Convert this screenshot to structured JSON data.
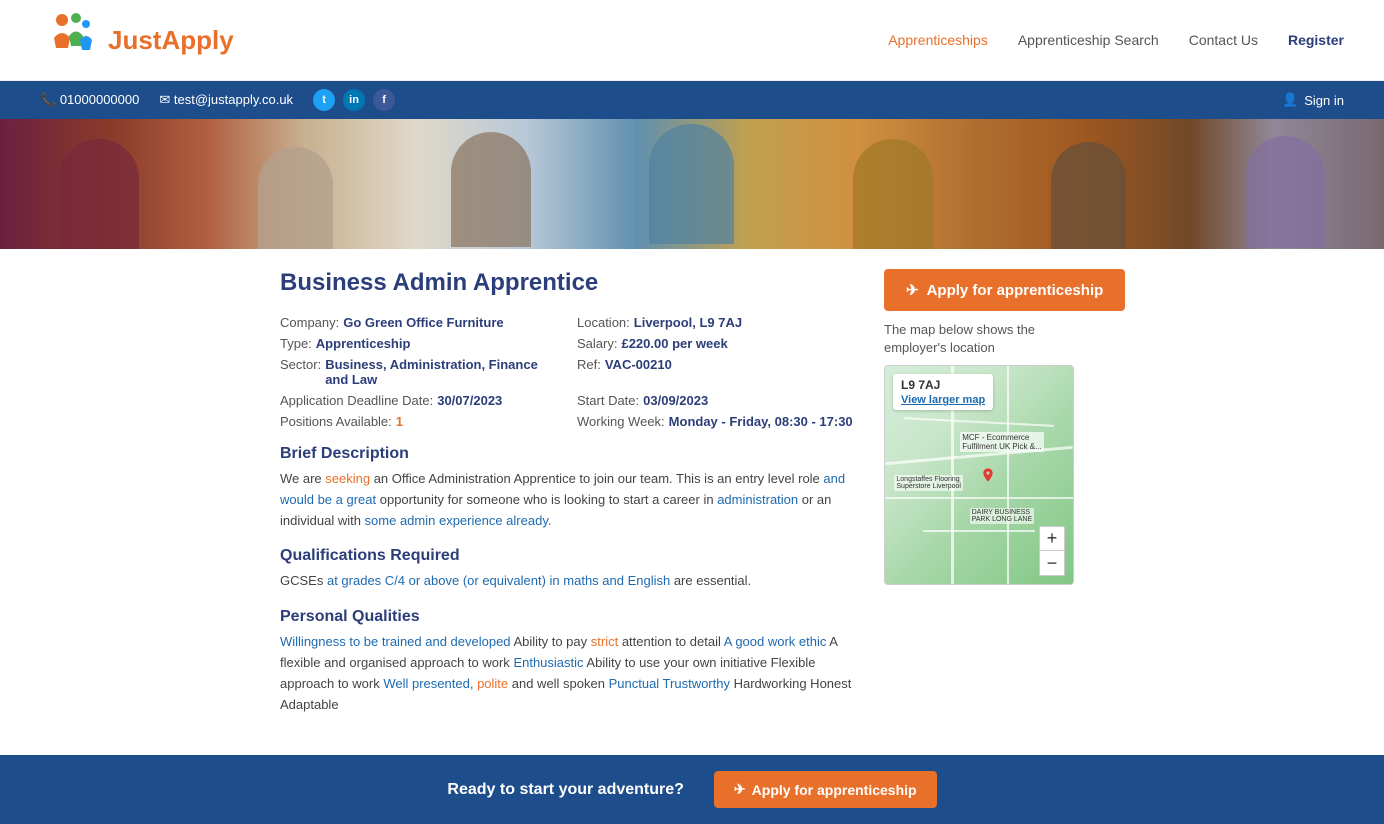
{
  "header": {
    "logo_text_part1": "Just",
    "logo_text_part2": "Apply",
    "nav": {
      "apprenticeships": "Apprenticeships",
      "search": "Apprenticeship Search",
      "contact": "Contact Us",
      "register": "Register"
    }
  },
  "topbar": {
    "phone": "01000000000",
    "email": "test@justapply.co.uk",
    "signin": "Sign in",
    "social": {
      "twitter": "t",
      "linkedin": "in",
      "facebook": "f"
    }
  },
  "job": {
    "title": "Business Admin Apprentice",
    "company_label": "Company:",
    "company_value": "Go Green Office Furniture",
    "location_label": "Location:",
    "location_value": "Liverpool, L9 7AJ",
    "type_label": "Type:",
    "type_value": "Apprenticeship",
    "salary_label": "Salary:",
    "salary_value": "£220.00 per week",
    "sector_label": "Sector:",
    "sector_value": "Business, Administration, Finance and Law",
    "ref_label": "Ref:",
    "ref_value": "VAC-00210",
    "deadline_label": "Application Deadline Date:",
    "deadline_value": "30/07/2023",
    "start_label": "Start Date:",
    "start_value": "03/09/2023",
    "positions_label": "Positions Available:",
    "positions_value": "1",
    "working_label": "Working Week:",
    "working_value": "Monday - Friday, 08:30 - 17:30",
    "apply_button": "Apply for apprenticeship",
    "brief_title": "Brief Description",
    "brief_text": "We are seeking an Office Administration Apprentice to join our team. This is an entry level role and would be a great opportunity for someone who is looking to start a career in administration or an individual with some admin experience already.",
    "qualifications_title": "Qualifications Required",
    "qualifications_text": "GCSEs at grades C/4 or above (or equivalent) in maths and English are essential.",
    "personal_title": "Personal Qualities",
    "personal_text": "Willingness to be trained and developed Ability to pay strict attention to detail A good work ethic A flexible and organised approach to work Enthusiastic Ability to use your own initiative Flexible approach to work Well presented, polite and well spoken Punctual Trustworthy Hardworking Honest Adaptable"
  },
  "sidebar": {
    "map_note": "The map below shows the employer's location",
    "map_label": "L9 7AJ",
    "map_link": "View larger map"
  },
  "footer": {
    "text": "Ready to start your adventure?",
    "apply_button": "Apply for apprenticeship"
  }
}
